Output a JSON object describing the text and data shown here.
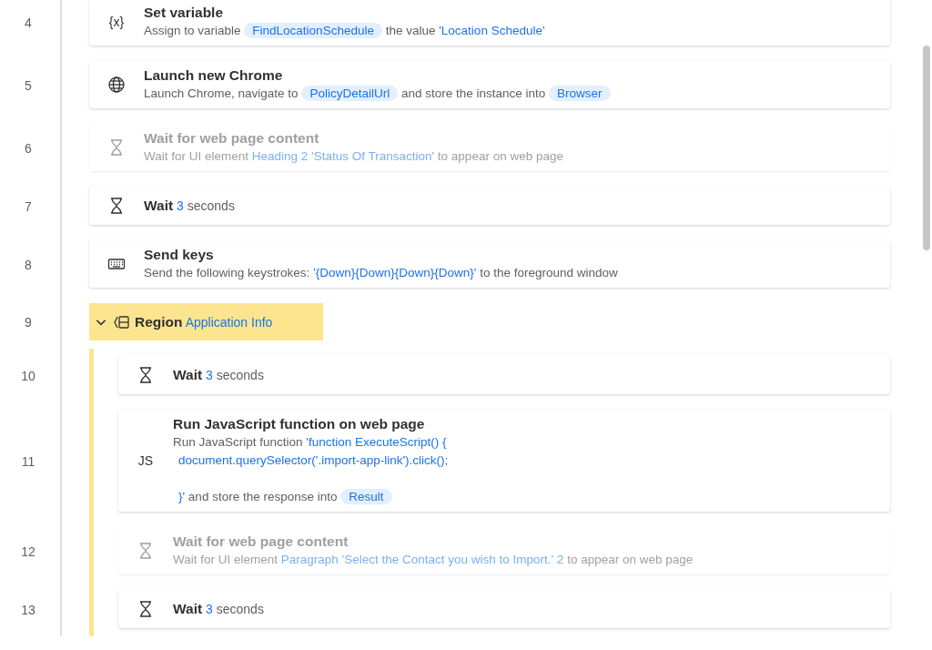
{
  "steps": [
    {
      "number": "4",
      "kind": "variable",
      "icon_text": "{x}",
      "inline": false,
      "disabled": false,
      "title": "Set variable",
      "detail": [
        {
          "kind": "text",
          "text": "Assign to variable"
        },
        {
          "kind": "chip",
          "text": "FindLocationSchedule"
        },
        {
          "kind": "text",
          "text": "the value"
        },
        {
          "kind": "value",
          "text": "'Location Schedule'"
        }
      ]
    },
    {
      "number": "5",
      "kind": "browser",
      "inline": false,
      "disabled": false,
      "title": "Launch new Chrome",
      "detail": [
        {
          "kind": "text",
          "text": "Launch Chrome, navigate to"
        },
        {
          "kind": "chip",
          "text": "PolicyDetailUrl"
        },
        {
          "kind": "text",
          "text": "and store the instance into"
        },
        {
          "kind": "chip",
          "text": "Browser"
        }
      ]
    },
    {
      "number": "6",
      "kind": "wait",
      "inline": false,
      "disabled": true,
      "title": "Wait for web page content",
      "detail": [
        {
          "kind": "text",
          "text": "Wait for UI element"
        },
        {
          "kind": "value",
          "text": "Heading 2 'Status Of Transaction'"
        },
        {
          "kind": "text",
          "text": "to appear on web page"
        }
      ]
    },
    {
      "number": "7",
      "kind": "wait",
      "inline": true,
      "disabled": false,
      "title": "Wait",
      "detail": [
        {
          "kind": "value",
          "text": "3"
        },
        {
          "kind": "text",
          "text": "seconds"
        }
      ]
    },
    {
      "number": "8",
      "kind": "keyboard",
      "inline": false,
      "disabled": false,
      "title": "Send keys",
      "detail": [
        {
          "kind": "text",
          "text": "Send the following keystrokes:"
        },
        {
          "kind": "value",
          "text": "'{Down}{Down}{Down}{Down}'"
        },
        {
          "kind": "text",
          "text": "to the foreground window"
        }
      ]
    },
    {
      "number": "9",
      "kind": "region",
      "expanded": true,
      "title": "Region",
      "detail": [
        {
          "kind": "value",
          "text": "Application Info"
        }
      ],
      "children": [
        {
          "number": "10",
          "kind": "wait",
          "inline": true,
          "disabled": false,
          "title": "Wait",
          "detail": [
            {
              "kind": "value",
              "text": "3"
            },
            {
              "kind": "text",
              "text": "seconds"
            }
          ]
        },
        {
          "number": "11",
          "kind": "script",
          "icon_text": "JS",
          "inline": false,
          "disabled": false,
          "title": "Run JavaScript function on web page",
          "detail": [
            {
              "kind": "text",
              "text": "Run JavaScript function"
            },
            {
              "kind": "value",
              "text": "'function ExecuteScript() {"
            },
            {
              "kind": "continuation",
              "text": "document.querySelector('.import-app-link').click();"
            },
            {
              "kind": "closing",
              "text": "}'"
            },
            {
              "kind": "text",
              "text": "and store the response into"
            },
            {
              "kind": "chip",
              "text": "Result"
            }
          ]
        },
        {
          "number": "12",
          "kind": "wait",
          "inline": false,
          "disabled": true,
          "title": "Wait for web page content",
          "detail": [
            {
              "kind": "text",
              "text": "Wait for UI element"
            },
            {
              "kind": "value",
              "text": "Paragraph 'Select the Contact you wish to Import.' 2"
            },
            {
              "kind": "text",
              "text": "to appear on web page"
            }
          ]
        },
        {
          "number": "13",
          "kind": "wait",
          "inline": true,
          "disabled": false,
          "title": "Wait",
          "detail": [
            {
              "kind": "value",
              "text": "3"
            },
            {
              "kind": "text",
              "text": "seconds"
            }
          ]
        }
      ]
    }
  ]
}
